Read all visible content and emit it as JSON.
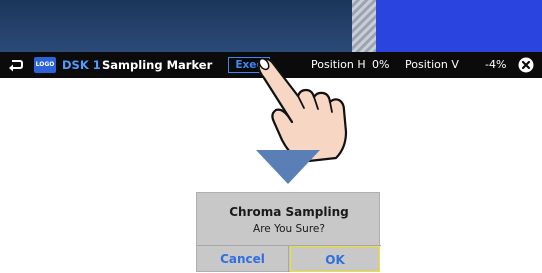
{
  "toolbar": {
    "back_icon": "back-arrow-icon",
    "logo_text": "LOGO",
    "dsk_label": "DSK 1",
    "title": "Sampling Marker",
    "exec_label": "Exec",
    "position_h_label": "Position H",
    "position_h_value": "0%",
    "position_v_label": "Position V",
    "position_v_value": "-4%",
    "close_icon": "close-icon",
    "accent_color": "#3f86f5"
  },
  "dialog": {
    "title": "Chroma Sampling",
    "message": "Are You Sure?",
    "cancel_label": "Cancel",
    "ok_label": "OK",
    "ok_highlight_color": "#f1e21c"
  },
  "annotation": {
    "hand_icon": "tap-hand-icon",
    "arrow_icon": "down-arrow-icon"
  }
}
